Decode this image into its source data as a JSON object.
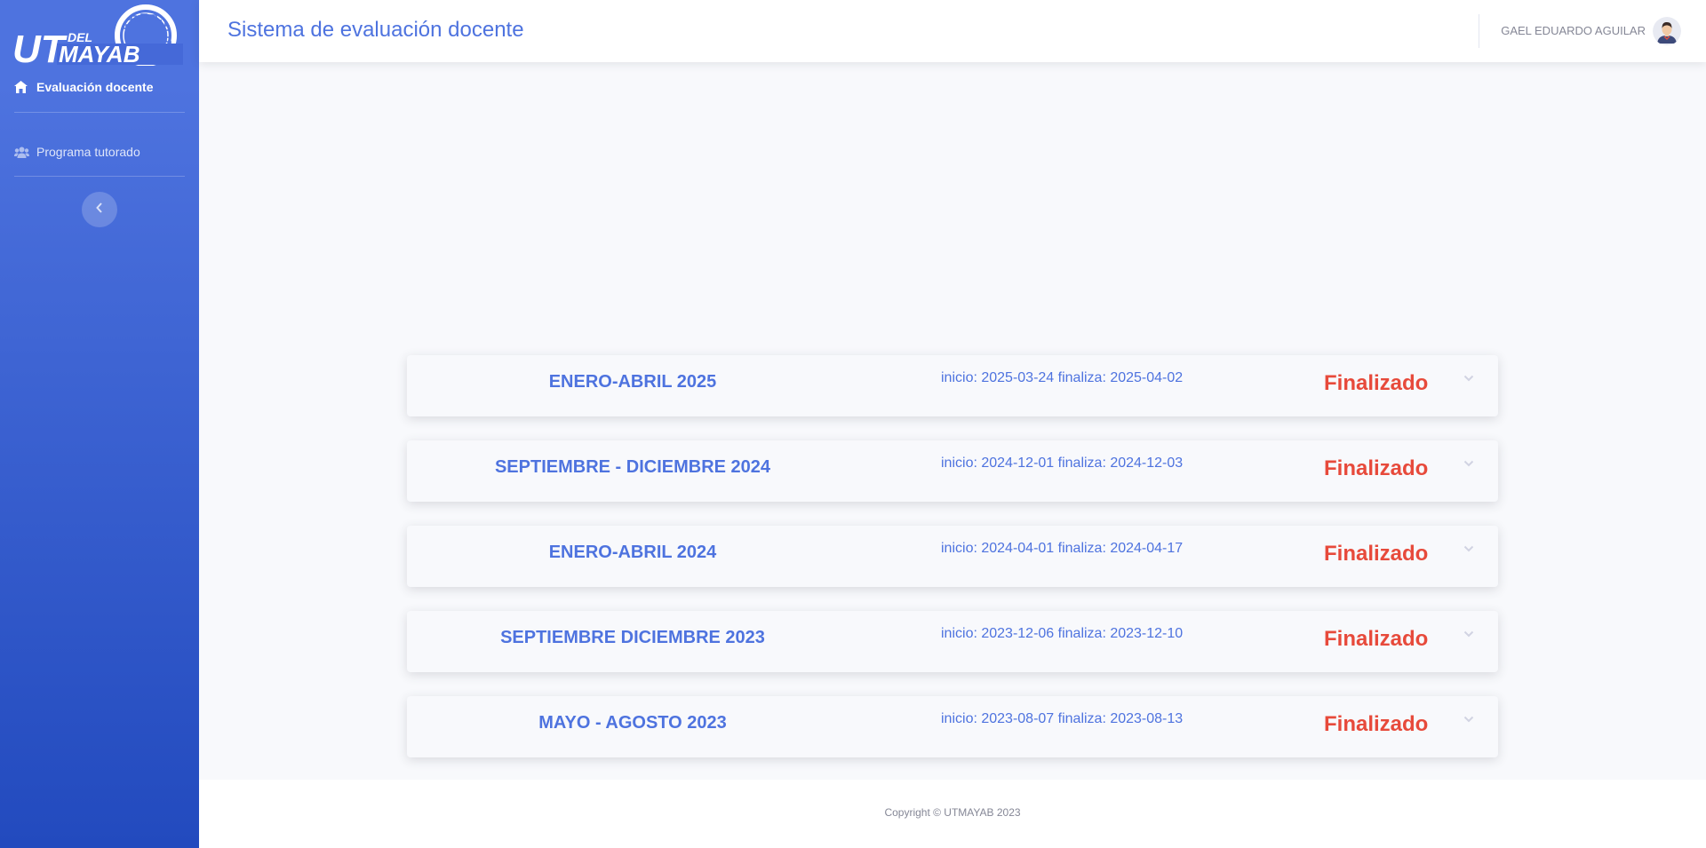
{
  "brand": {
    "logo_text": "UTMAYAB",
    "logo_small_text": "DEL",
    "accent_color": "#4e73df"
  },
  "sidebar": {
    "items": [
      {
        "label": "Evaluación docente",
        "icon": "home-icon",
        "active": true
      },
      {
        "label": "Programa tutorado",
        "icon": "users-icon",
        "active": false
      }
    ],
    "toggle_icon": "chevron-left-icon"
  },
  "header": {
    "title": "Sistema de evaluación docente",
    "user_name": "GAEL EDUARDO AGUILAR",
    "avatar_icon": "user-avatar-icon"
  },
  "evaluations": [
    {
      "title": "ENERO-ABRIL 2025",
      "dates": "inicio: 2025-03-24 finaliza: 2025-04-02",
      "status": "Finalizado"
    },
    {
      "title": "SEPTIEMBRE - DICIEMBRE 2024",
      "dates": "inicio: 2024-12-01 finaliza: 2024-12-03",
      "status": "Finalizado"
    },
    {
      "title": "ENERO-ABRIL 2024",
      "dates": "inicio: 2024-04-01 finaliza: 2024-04-17",
      "status": "Finalizado"
    },
    {
      "title": "SEPTIEMBRE DICIEMBRE 2023",
      "dates": "inicio: 2023-12-06 finaliza: 2023-12-10",
      "status": "Finalizado"
    },
    {
      "title": "MAYO - AGOSTO 2023",
      "dates": "inicio: 2023-08-07 finaliza: 2023-08-13",
      "status": "Finalizado"
    }
  ],
  "status_color": "#e74a3b",
  "footer": {
    "copyright": "Copyright © UTMAYAB 2023"
  }
}
